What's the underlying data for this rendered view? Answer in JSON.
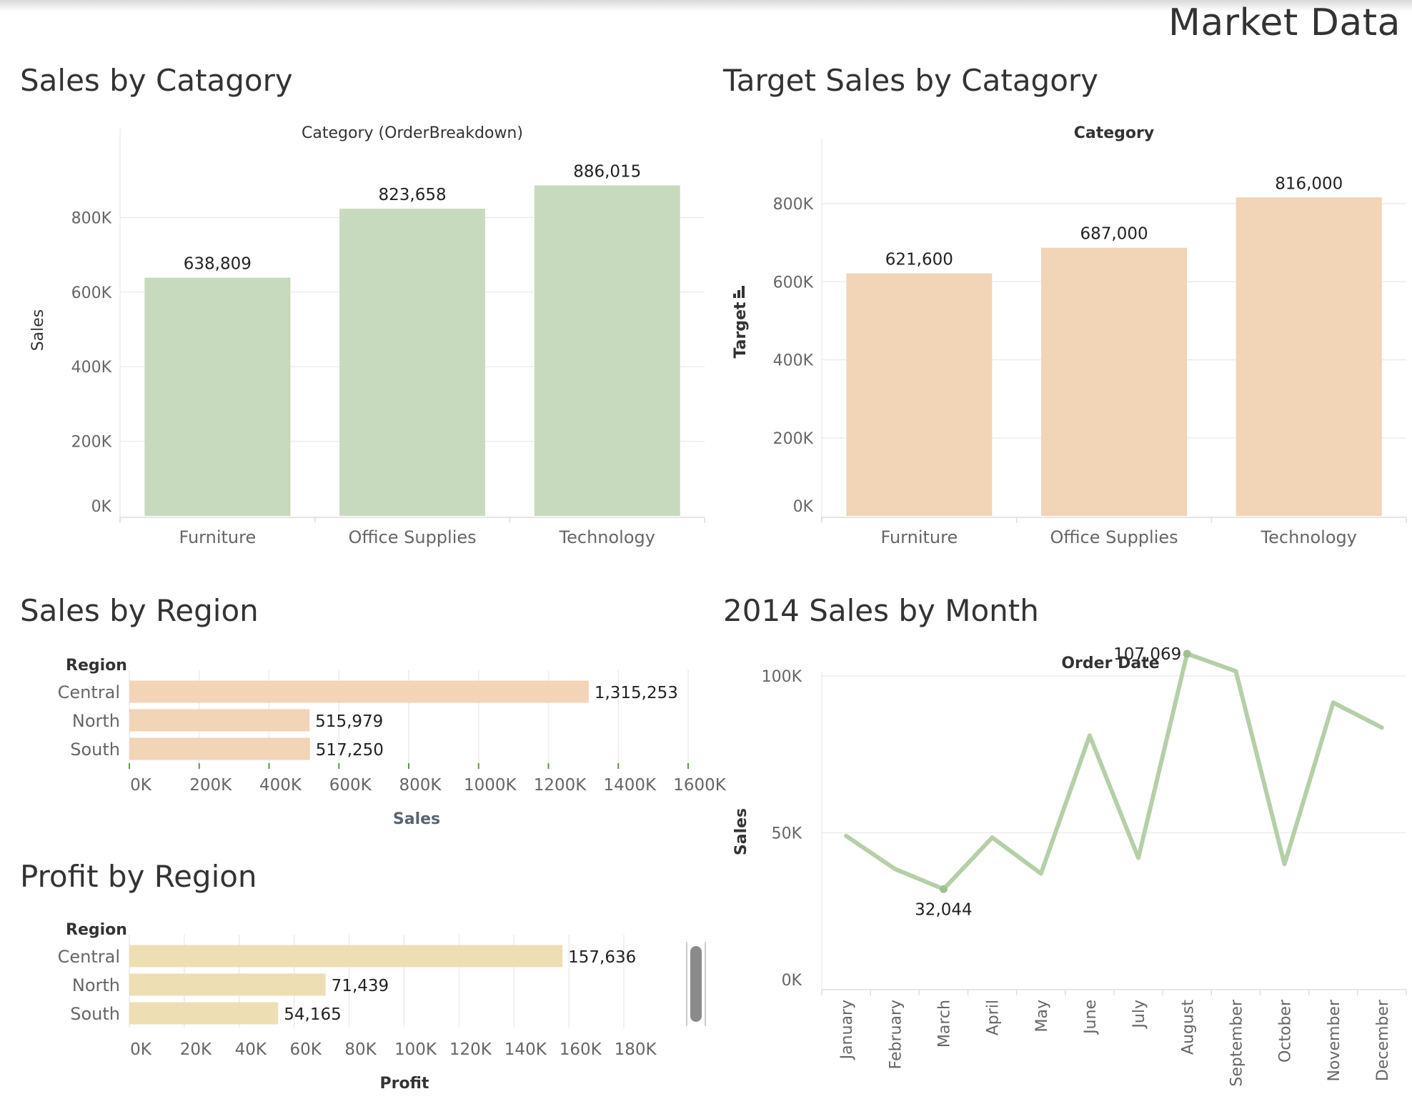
{
  "dashboard_title": "Market Data",
  "sheets": {
    "sales_by_category": "Sales by Catagory",
    "target_by_category": "Target Sales by Catagory",
    "sales_by_region": "Sales by Region",
    "monthly_sales": "2014 Sales by Month",
    "profit_by_region": "Profit by Region"
  },
  "colors": {
    "green": "#c8dabd",
    "peach": "#f2d4b6",
    "tan": "#eddeb3",
    "line": "#b5cfa7"
  },
  "chart_data": [
    {
      "id": "sales_by_category",
      "type": "bar",
      "title": "Sales by Catagory",
      "xlabel": "Category (OrderBreakdown)",
      "ylabel": "Sales",
      "categories": [
        "Furniture",
        "Office Supplies",
        "Technology"
      ],
      "values": [
        638809,
        823658,
        886015
      ],
      "value_labels": [
        "638,809",
        "823,658",
        "886,015"
      ],
      "ylim": [
        0,
        1000000
      ],
      "yticks": [
        0,
        200000,
        400000,
        600000,
        800000
      ],
      "ytick_labels": [
        "0K",
        "200K",
        "400K",
        "600K",
        "800K"
      ],
      "grid": true
    },
    {
      "id": "target_by_category",
      "type": "bar",
      "title": "Target Sales by Catagory",
      "xlabel": "Category",
      "ylabel": "Target",
      "categories": [
        "Furniture",
        "Office Supplies",
        "Technology"
      ],
      "values": [
        621600,
        687000,
        816000
      ],
      "value_labels": [
        "621,600",
        "687,000",
        "816,000"
      ],
      "ylim": [
        0,
        930000
      ],
      "yticks": [
        0,
        200000,
        400000,
        600000,
        800000
      ],
      "ytick_labels": [
        "0K",
        "200K",
        "400K",
        "600K",
        "800K"
      ],
      "grid": true
    },
    {
      "id": "sales_by_region",
      "type": "bar",
      "orientation": "horizontal",
      "title": "Sales by Region",
      "row_header": "Region",
      "xlabel": "Sales",
      "categories": [
        "Central",
        "North",
        "South"
      ],
      "values": [
        1315253,
        515979,
        517250
      ],
      "value_labels": [
        "1,315,253",
        "515,979",
        "517,250"
      ],
      "xlim": [
        0,
        1600000
      ],
      "xticks": [
        0,
        200000,
        400000,
        600000,
        800000,
        1000000,
        1200000,
        1400000,
        1600000
      ],
      "xtick_labels": [
        "0K",
        "200K",
        "400K",
        "600K",
        "800K",
        "1000K",
        "1200K",
        "1400K",
        "1600K"
      ]
    },
    {
      "id": "profit_by_region",
      "type": "bar",
      "orientation": "horizontal",
      "title": "Profit by Region",
      "row_header": "Region",
      "xlabel": "Profit",
      "categories": [
        "Central",
        "North",
        "South"
      ],
      "values": [
        157636,
        71439,
        54165
      ],
      "value_labels": [
        "157,636",
        "71,439",
        "54,165"
      ],
      "xlim": [
        0,
        200000
      ],
      "xticks": [
        0,
        20000,
        40000,
        60000,
        80000,
        100000,
        120000,
        140000,
        160000,
        180000
      ],
      "xtick_labels": [
        "0K",
        "20K",
        "40K",
        "60K",
        "80K",
        "100K",
        "120K",
        "140K",
        "160K",
        "180K"
      ]
    },
    {
      "id": "monthly_sales",
      "type": "line",
      "title": "2014 Sales by Month",
      "xlabel": "Order Date",
      "ylabel": "Sales",
      "x": [
        "January",
        "February",
        "March",
        "April",
        "May",
        "June",
        "July",
        "August",
        "September",
        "October",
        "November",
        "December"
      ],
      "values": [
        49000,
        38500,
        32044,
        48500,
        37000,
        81000,
        42000,
        107069,
        101500,
        40000,
        91500,
        83500
      ],
      "point_labels": {
        "2": "32,044",
        "7": "107,069"
      },
      "ylim": [
        0,
        115000
      ],
      "yticks": [
        0,
        50000,
        100000
      ],
      "ytick_labels": [
        "0K",
        "50K",
        "100K"
      ],
      "grid": true
    }
  ]
}
